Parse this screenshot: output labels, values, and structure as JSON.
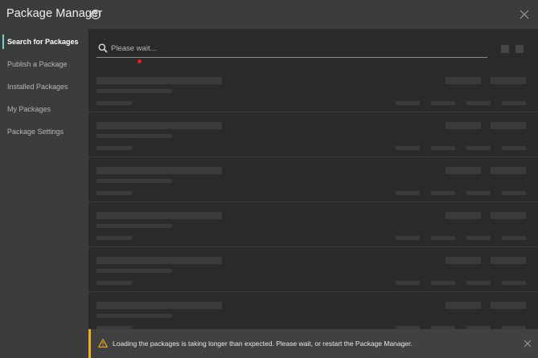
{
  "window": {
    "title": "Package Manager"
  },
  "sidebar": {
    "items": [
      {
        "label": "Search for Packages",
        "active": true
      },
      {
        "label": "Publish a Package",
        "active": false
      },
      {
        "label": "Installed Packages",
        "active": false
      },
      {
        "label": "My Packages",
        "active": false
      },
      {
        "label": "Package Settings",
        "active": false
      }
    ]
  },
  "search": {
    "placeholder": "Please wait...",
    "value": ""
  },
  "results": {
    "state": "loading",
    "placeholder_rows": 6
  },
  "toast": {
    "type": "warning",
    "message": "Loading the packages is taking longer than expected. Please wait, or restart the Package Manager."
  },
  "colors": {
    "accent": "#6fd6d0",
    "warning": "#f0ad22",
    "background": "#2a2a2a",
    "panel": "#3c3c3c"
  },
  "icons": {
    "help": "help-icon",
    "close": "close-icon",
    "search": "search-icon",
    "warning": "warning-icon"
  }
}
